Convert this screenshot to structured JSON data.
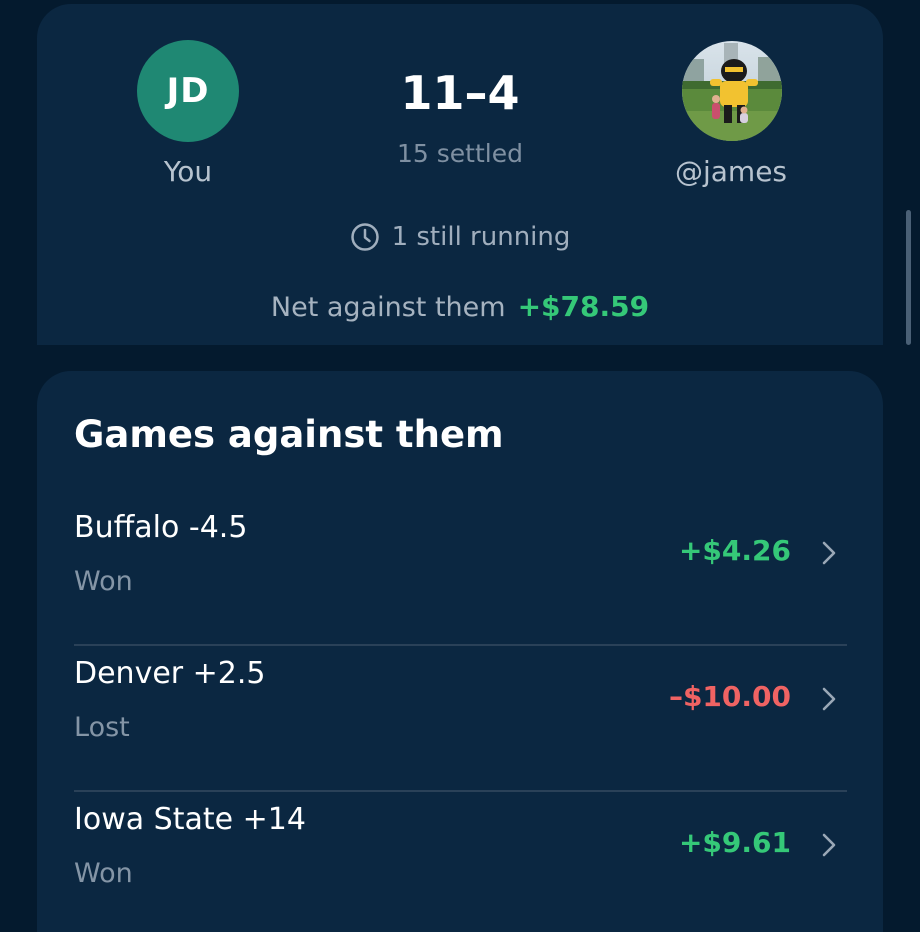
{
  "summary": {
    "you": {
      "initials": "JD",
      "label": "You",
      "avatar_color": "#1f8873"
    },
    "record": "11–4",
    "settled": "15 settled",
    "opponent": {
      "handle": "@james"
    },
    "running": "1 still running",
    "net": {
      "label": "Net against them",
      "value": "+$78.59"
    }
  },
  "games": {
    "title": "Games against them",
    "items": [
      {
        "name": "Buffalo -4.5",
        "status": "Won",
        "amount": "+$4.26"
      },
      {
        "name": "Denver +2.5",
        "status": "Lost",
        "amount": "–$10.00"
      },
      {
        "name": "Iowa State +14",
        "status": "Won",
        "amount": "+$9.61"
      }
    ]
  },
  "colors": {
    "background": "#041a2e",
    "card": "#0b2741",
    "positive": "#35c878",
    "negative": "#f06363"
  },
  "icons": {
    "running": "clock-icon",
    "row_action": "chevron-right-icon"
  }
}
